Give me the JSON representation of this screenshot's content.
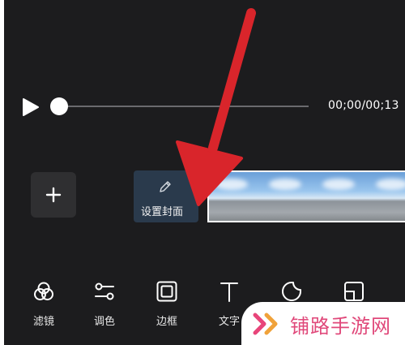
{
  "player": {
    "timecode": "00;00/00;13"
  },
  "timeline": {
    "cover_label": "设置封面"
  },
  "toolbar": {
    "items": [
      {
        "label": "滤镜",
        "icon": "filter-icon"
      },
      {
        "label": "调色",
        "icon": "adjust-color-icon"
      },
      {
        "label": "边框",
        "icon": "border-icon"
      },
      {
        "label": "文字",
        "icon": "text-icon"
      },
      {
        "label": "",
        "icon": "sticker-icon"
      },
      {
        "label": "",
        "icon": "crop-icon"
      }
    ]
  },
  "watermark": {
    "text": "铺路手游网"
  },
  "colors": {
    "background": "#1c1c1e",
    "arrow": "#d9252b",
    "watermark_text": "#e0487a",
    "watermark_logo": "#e8457a"
  }
}
